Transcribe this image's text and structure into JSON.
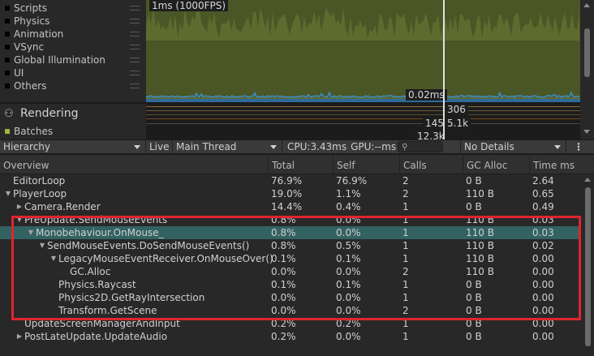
{
  "legend": {
    "items": [
      {
        "label": "Scripts"
      },
      {
        "label": "Physics"
      },
      {
        "label": "Animation"
      },
      {
        "label": "VSync"
      },
      {
        "label": "Global Illumination"
      },
      {
        "label": "UI"
      },
      {
        "label": "Others"
      }
    ]
  },
  "cpu_chart": {
    "fps_label": "1ms (1000FPS)",
    "frame_ms_label": "0.02ms"
  },
  "rendering": {
    "title": "Rendering",
    "batches_label": "Batches",
    "values": [
      "306",
      "145",
      "5.1k",
      "12.3k"
    ]
  },
  "toolbar": {
    "view_mode": "Hierarchy",
    "live_label": "Live",
    "thread": "Main Thread",
    "cpu_label": "CPU:3.43ms",
    "gpu_label": "GPU:--ms",
    "details": "No Details",
    "kebab": "⋮"
  },
  "table": {
    "headers": [
      "Overview",
      "Total",
      "Self",
      "Calls",
      "GC Alloc",
      "Time ms"
    ],
    "rows": [
      {
        "indent": 0,
        "tri": "",
        "name": "EditorLoop",
        "total": "76.9%",
        "self": "76.9%",
        "calls": "2",
        "gc": "0 B",
        "time": "2.64"
      },
      {
        "indent": 0,
        "tri": "▼",
        "name": "PlayerLoop",
        "total": "19.0%",
        "self": "1.1%",
        "calls": "2",
        "gc": "110 B",
        "time": "0.65"
      },
      {
        "indent": 1,
        "tri": "▶",
        "name": "Camera.Render",
        "total": "14.4%",
        "self": "0.4%",
        "calls": "1",
        "gc": "0 B",
        "time": "0.49"
      },
      {
        "indent": 1,
        "tri": "▼",
        "name": "PreUpdate.SendMouseEvents",
        "total": "0.8%",
        "self": "0.0%",
        "calls": "1",
        "gc": "110 B",
        "time": "0.03"
      },
      {
        "indent": 2,
        "tri": "▼",
        "name": "Monobehaviour.OnMouse_",
        "total": "0.8%",
        "self": "0.0%",
        "calls": "1",
        "gc": "110 B",
        "time": "0.03",
        "highlight": true
      },
      {
        "indent": 3,
        "tri": "▼",
        "name": "SendMouseEvents.DoSendMouseEvents()",
        "total": "0.8%",
        "self": "0.5%",
        "calls": "1",
        "gc": "110 B",
        "time": "0.02"
      },
      {
        "indent": 4,
        "tri": "▼",
        "name": "LegacyMouseEventReceiver.OnMouseOver()",
        "total": "0.1%",
        "self": "0.1%",
        "calls": "1",
        "gc": "110 B",
        "time": "0.00"
      },
      {
        "indent": 5,
        "tri": "",
        "name": "GC.Alloc",
        "total": "0.0%",
        "self": "0.0%",
        "calls": "2",
        "gc": "110 B",
        "time": "0.00"
      },
      {
        "indent": 4,
        "tri": "",
        "name": "Physics.Raycast",
        "total": "0.1%",
        "self": "0.1%",
        "calls": "1",
        "gc": "0 B",
        "time": "0.00"
      },
      {
        "indent": 4,
        "tri": "",
        "name": "Physics2D.GetRayIntersection",
        "total": "0.0%",
        "self": "0.0%",
        "calls": "1",
        "gc": "0 B",
        "time": "0.00"
      },
      {
        "indent": 4,
        "tri": "",
        "name": "Transform.GetScene",
        "total": "0.0%",
        "self": "0.0%",
        "calls": "2",
        "gc": "0 B",
        "time": "0.00"
      },
      {
        "indent": 1,
        "tri": "",
        "name": "UpdateScreenManagerAndInput",
        "total": "0.2%",
        "self": "0.2%",
        "calls": "1",
        "gc": "0 B",
        "time": "0.00"
      },
      {
        "indent": 1,
        "tri": "▶",
        "name": "PostLateUpdate.UpdateAudio",
        "total": "0.2%",
        "self": "0.0%",
        "calls": "1",
        "gc": "0 B",
        "time": "0.00"
      },
      {
        "indent": 1,
        "tri": "",
        "name": "",
        "total": "",
        "self": "",
        "calls": "",
        "gc": "",
        "time": ""
      }
    ]
  },
  "colors": {
    "cpu_fill": "#4b5626",
    "cpu_spikes": "#5d6b2f",
    "scripts_line": "#3b8fd0",
    "highlight_row": "#336262",
    "annotation_box": "#e0242c"
  }
}
